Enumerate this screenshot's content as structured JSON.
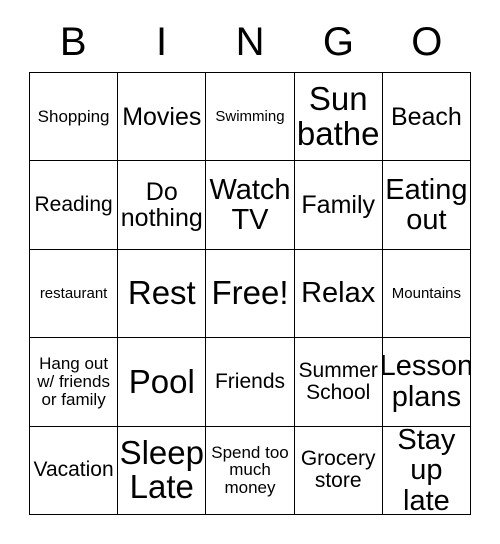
{
  "card": {
    "headers": [
      "B",
      "I",
      "N",
      "G",
      "O"
    ],
    "rows": [
      [
        {
          "text": "Shopping",
          "size": "fs-sm"
        },
        {
          "text": "Movies",
          "size": "fs-lg"
        },
        {
          "text": "Swimming",
          "size": "fs-xs"
        },
        {
          "text": "Sun\nbathe",
          "size": "fs-xxl"
        },
        {
          "text": "Beach",
          "size": "fs-lg"
        }
      ],
      [
        {
          "text": "Reading",
          "size": "fs-md"
        },
        {
          "text": "Do\nnothing",
          "size": "fs-lg"
        },
        {
          "text": "Watch\nTV",
          "size": "fs-xl"
        },
        {
          "text": "Family",
          "size": "fs-lg"
        },
        {
          "text": "Eating\nout",
          "size": "fs-xl"
        }
      ],
      [
        {
          "text": "restaurant",
          "size": "fs-xs"
        },
        {
          "text": "Rest",
          "size": "fs-xxl"
        },
        {
          "text": "Free!",
          "size": "fs-xxl"
        },
        {
          "text": "Relax",
          "size": "fs-xl"
        },
        {
          "text": "Mountains",
          "size": "fs-xs"
        }
      ],
      [
        {
          "text": "Hang out\nw/ friends\nor family",
          "size": "fs-sm"
        },
        {
          "text": "Pool",
          "size": "fs-xxl"
        },
        {
          "text": "Friends",
          "size": "fs-md"
        },
        {
          "text": "Summer\nSchool",
          "size": "fs-md"
        },
        {
          "text": "Lesson\nplans",
          "size": "fs-xl"
        }
      ],
      [
        {
          "text": "Vacation",
          "size": "fs-md"
        },
        {
          "text": "Sleep\nLate",
          "size": "fs-xxl"
        },
        {
          "text": "Spend too\nmuch\nmoney",
          "size": "fs-sm"
        },
        {
          "text": "Grocery\nstore",
          "size": "fs-md"
        },
        {
          "text": "Stay\nup late",
          "size": "fs-xl"
        }
      ]
    ],
    "free_space_label": "Free!",
    "colors": {
      "background": "#ffffff",
      "text": "#000000",
      "border": "#000000"
    }
  }
}
